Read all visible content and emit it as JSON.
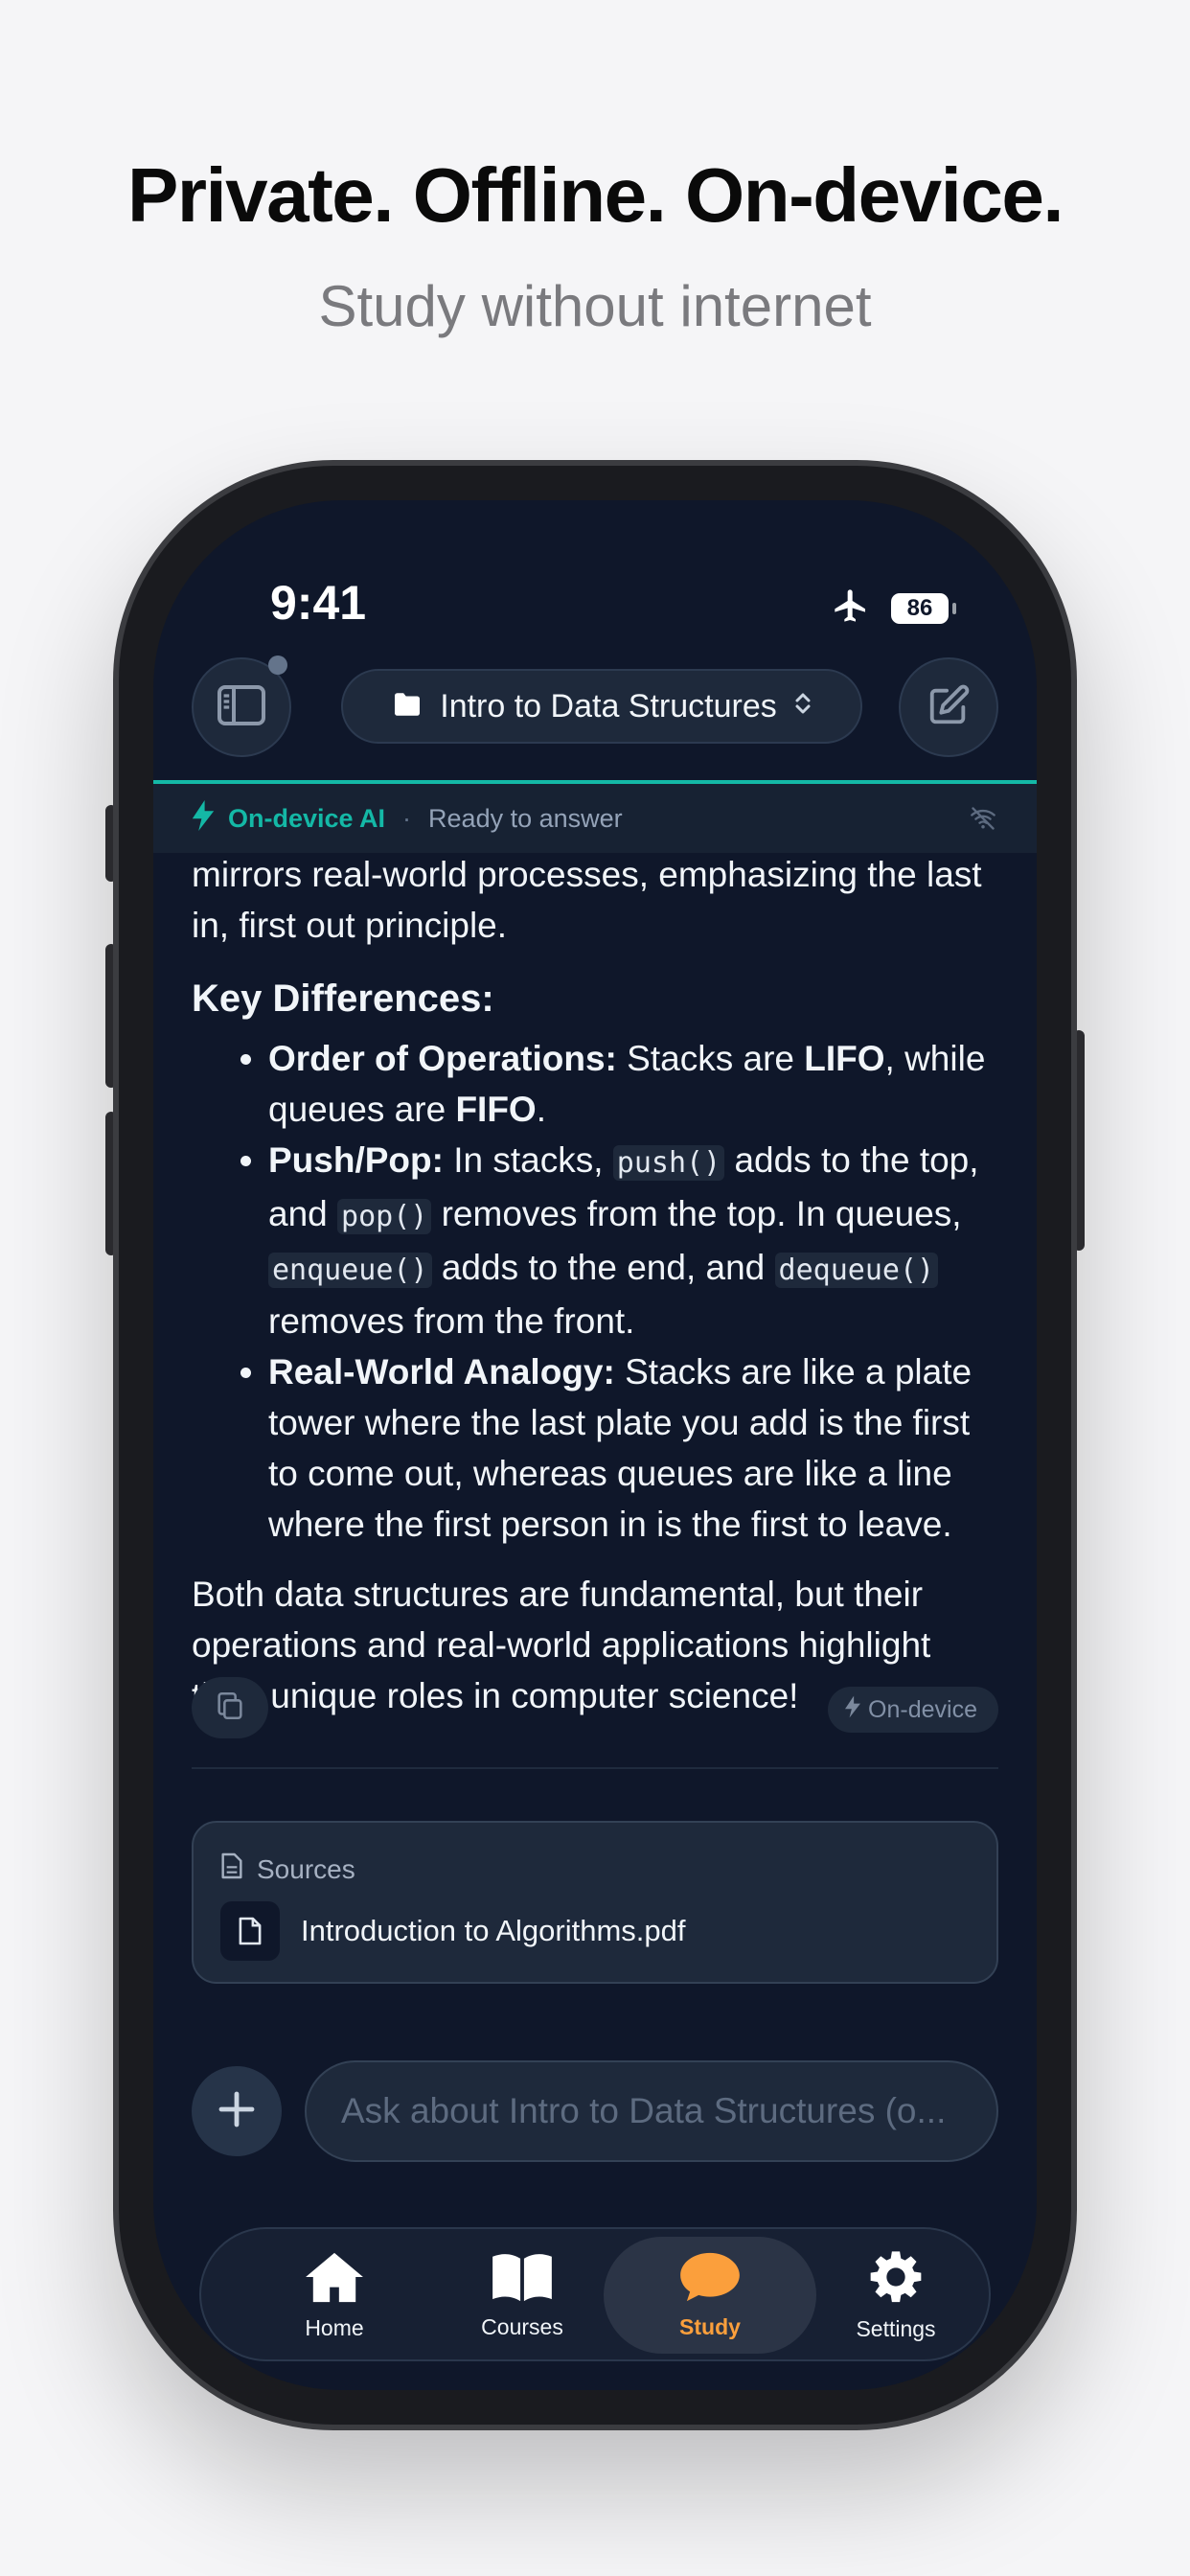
{
  "promo": {
    "title": "Private. Offline. On-device.",
    "subtitle": "Study without internet"
  },
  "status_bar": {
    "time": "9:41",
    "battery": "86"
  },
  "top_bar": {
    "course": "Intro to Data Structures"
  },
  "ai_bar": {
    "label": "On-device AI",
    "separator": "·",
    "status": "Ready to answer"
  },
  "message": {
    "intro_line": "mirrors real-world processes, emphasizing the last in, first out principle.",
    "heading": "Key Differences:",
    "items": [
      {
        "title": "Order of Operations:",
        "t1": " Stacks are ",
        "b1": "LIFO",
        "t2": ", while queues are ",
        "b2": "FIFO",
        "t3": "."
      },
      {
        "title": "Push/Pop:",
        "t1": " In stacks, ",
        "c1": "push()",
        "t2": " adds to the top, and ",
        "c2": "pop()",
        "t3": " removes from the top. In queues, ",
        "c3": "enqueue()",
        "t4": " adds to the end, and ",
        "c4": "dequeue()",
        "t5": " removes from the front."
      },
      {
        "title": "Real-World Analogy:",
        "text": " Stacks are like a plate tower where the last plate you add is the first to come out, whereas queues are like a line where the first person in is the first to leave."
      }
    ],
    "conclusion": "Both data structures are fundamental, but their operations and real-world applications highlight their unique roles in computer science!",
    "badge": "On-device"
  },
  "sources": {
    "label": "Sources",
    "files": [
      "Introduction to Algorithms.pdf"
    ]
  },
  "composer": {
    "placeholder": "Ask about Intro to Data Structures (o..."
  },
  "tabs": [
    {
      "label": "Home",
      "icon": "home-icon"
    },
    {
      "label": "Courses",
      "icon": "book-icon"
    },
    {
      "label": "Study",
      "icon": "chat-bubble-icon",
      "active": true
    },
    {
      "label": "Settings",
      "icon": "gear-icon"
    }
  ],
  "colors": {
    "accent_teal": "#14b8a6",
    "accent_orange": "#fb9f3c",
    "background": "#0f172a"
  }
}
